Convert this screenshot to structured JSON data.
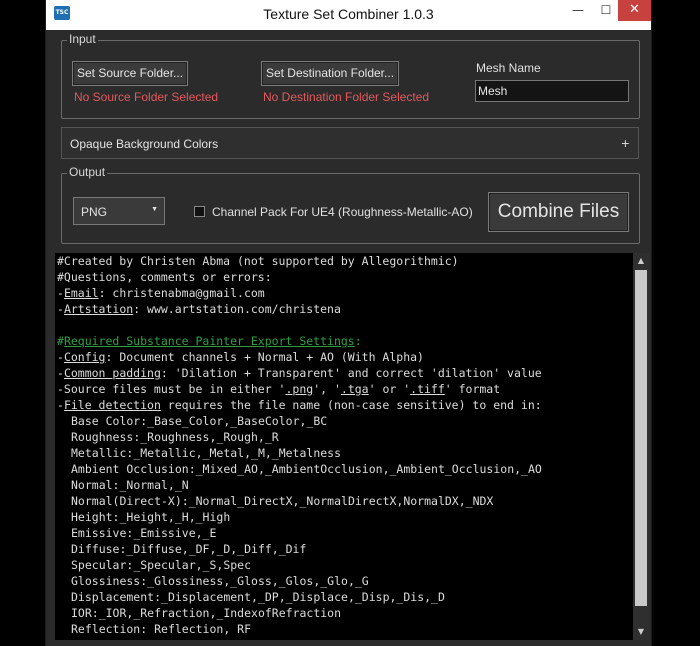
{
  "window": {
    "title": "Texture Set Combiner 1.0.3",
    "icon_text": "TSC",
    "minimize_glyph": "—",
    "maximize_glyph": "☐",
    "close_glyph": "✕"
  },
  "input_group": {
    "legend": "Input",
    "source_button": "Set Source Folder...",
    "source_status": "No Source Folder Selected",
    "destination_button": "Set Destination Folder...",
    "destination_status": "No Destination Folder Selected",
    "mesh_name_label": "Mesh Name",
    "mesh_name_value": "Mesh"
  },
  "collapsible": {
    "label": "Opaque Background Colors",
    "toggle": "+"
  },
  "output_group": {
    "legend": "Output",
    "format_selected": "PNG",
    "channel_pack_label": "Channel Pack For UE4 (Roughness-Metallic-AO)",
    "channel_pack_checked": false,
    "combine_button": "Combine Files"
  },
  "console": {
    "line1": "#Created by Christen Abma (not supported by Allegorithmic)",
    "line2": "#Questions, comments or errors:",
    "email_key": "Email",
    "email_val": ": christenabma@gmail.com",
    "artstation_key": "Artstation",
    "artstation_val": ": www.artstation.com/christena",
    "heading_pre": "#",
    "heading": "Required Substance Painter Export Settings",
    "heading_post": ":",
    "config_key": "Config",
    "config_val": ": Document channels + Normal + AO (With Alpha)",
    "padding_key": "Common padding",
    "padding_val": ": 'Dilation + Transparent' and correct 'dilation' value",
    "source_files_a": "-Source files must be in either '",
    "png": ".png",
    "sep1": "', '",
    "tga": ".tga",
    "sep2": "' or '",
    "tiff": ".tiff",
    "source_files_b": "' format",
    "detect_key": "File detection",
    "detect_val": " requires the file name (non-case sensitive) to end in:",
    "maps": [
      {
        "name": "Base Color",
        "suffixes": ":_Base_Color,_BaseColor,_BC"
      },
      {
        "name": "Roughness",
        "suffixes": ":_Roughness,_Rough,_R"
      },
      {
        "name": "Metallic",
        "suffixes": ":_Metallic,_Metal,_M,_Metalness"
      },
      {
        "name": "Ambient Occlusion",
        "suffixes": ":_Mixed_AO,_AmbientOcclusion,_Ambient_Occlusion,_AO"
      },
      {
        "name": "Normal",
        "suffixes": ":_Normal,_N"
      },
      {
        "name": "Normal(Direct-X)",
        "suffixes": ":_Normal_DirectX,_NormalDirectX,NormalDX,_NDX"
      },
      {
        "name": "Height",
        "suffixes": ":_Height,_H,_High"
      },
      {
        "name": "Emissive",
        "suffixes": ":_Emissive,_E"
      },
      {
        "name": "Diffuse",
        "suffixes": ":_Diffuse,_DF,_D,_Diff,_Dif"
      },
      {
        "name": "Specular",
        "suffixes": ":_Specular,_S,Spec"
      },
      {
        "name": "Glossiness",
        "suffixes": ":_Glossiness,_Gloss,_Glos,_Glo,_G"
      },
      {
        "name": "Displacement",
        "suffixes": ":_Displacement,_DP,_Displace,_Disp,_Dis,_D"
      },
      {
        "name": "IOR",
        "suffixes": ":_IOR,_Refraction,_IndexofRefraction"
      },
      {
        "name": "Reflection",
        "suffixes": ": Reflection, RF"
      }
    ]
  },
  "scrollbar": {
    "up_glyph": "▲",
    "down_glyph": "▼"
  },
  "colors": {
    "error": "#e4585b",
    "heading": "#2ea043",
    "close": "#c7413e"
  }
}
